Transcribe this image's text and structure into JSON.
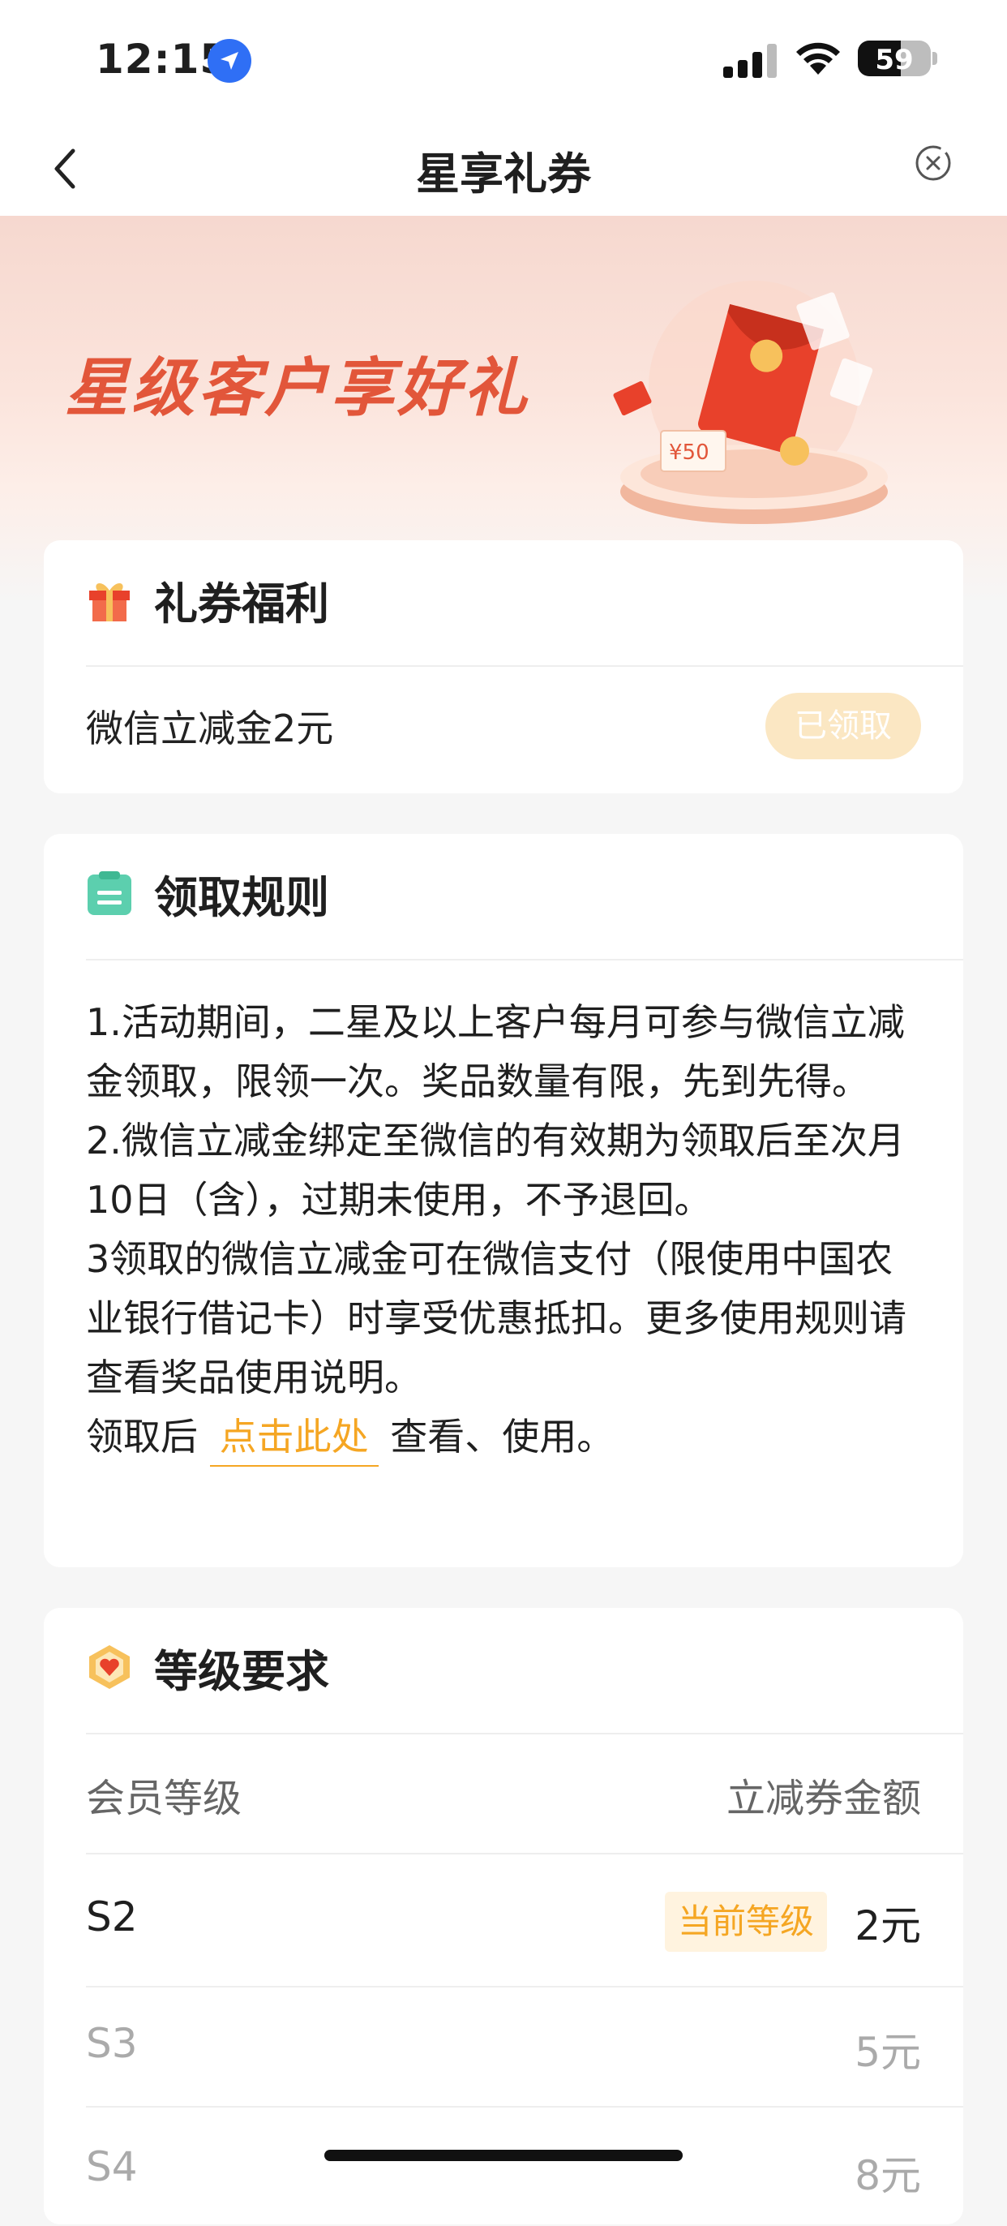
{
  "status": {
    "time": "12:15",
    "battery": "59"
  },
  "nav": {
    "title": "星享礼券"
  },
  "banner": {
    "title": "星级客户享好礼",
    "coupon_value": "¥50"
  },
  "gift_card": {
    "header": "礼券福利",
    "item": "微信立减金2元",
    "status_button": "已领取"
  },
  "rules_card": {
    "header": "领取规则",
    "lines": [
      "1.活动期间，二星及以上客户每月可参与微信立减金领取，限领一次。奖品数量有限，先到先得。",
      "2.微信立减金绑定至微信的有效期为领取后至次月10日（含），过期未使用，不予退回。",
      "3领取的微信立减金可在微信支付（限使用中国农业银行借记卡）时享受优惠抵扣。更多使用规则请查看奖品使用说明。"
    ],
    "footer_prefix": "领取后",
    "footer_link": "点击此处",
    "footer_suffix": "查看、使用。"
  },
  "level_card": {
    "header": "等级要求",
    "col_level": "会员等级",
    "col_amount": "立减券金额",
    "rows": [
      {
        "level": "S2",
        "tag": "当前等级",
        "amount": "2元"
      },
      {
        "level": "S3",
        "amount": "5元"
      },
      {
        "level": "S4",
        "amount": "8元"
      }
    ]
  },
  "colors": {
    "accent": "#f5a623",
    "banner_title": "#e2563a",
    "icon_green": "#5ccfae"
  }
}
